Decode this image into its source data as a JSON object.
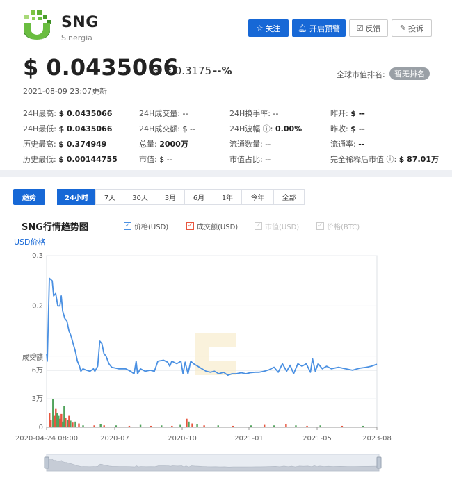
{
  "coin": {
    "symbol": "SNG",
    "name": "Sinergia"
  },
  "header_buttons": {
    "follow": "关注",
    "alert": "开启预警",
    "feedback": "反馈",
    "complain": "投诉"
  },
  "price": {
    "usd": "$ 0.0435066",
    "cny": "≈ ¥ 0.3175",
    "change": "--%",
    "rank_label": "全球市值排名:",
    "rank_value": "暂无排名",
    "updated": "2021-08-09 23:07更新"
  },
  "stats": [
    {
      "key": "24H最高:",
      "value": "$ 0.0435066"
    },
    {
      "key": "24H最低:",
      "value": "$ 0.0435066"
    },
    {
      "key": "历史最高:",
      "value": "$ 0.374949"
    },
    {
      "key": "历史最低:",
      "value": "$ 0.00144755"
    },
    {
      "key": "24H成交量:",
      "value": "--"
    },
    {
      "key": "24H成交额:",
      "value": "$ --"
    },
    {
      "key": "总量:",
      "value": "2000万"
    },
    {
      "key": "市值:",
      "value": "$ --"
    },
    {
      "key": "24H换手率:",
      "value": "--"
    },
    {
      "key": "24H波幅 ⓘ:",
      "value": "0.00%"
    },
    {
      "key": "流通数量:",
      "value": "--"
    },
    {
      "key": "市值占比:",
      "value": "--"
    },
    {
      "key": "昨开:",
      "value": "$ --"
    },
    {
      "key": "昨收:",
      "value": "$ --"
    },
    {
      "key": "流通率:",
      "value": "--"
    },
    {
      "key": "完全稀释后市值 ⓘ:",
      "value": "$ 87.01万"
    }
  ],
  "trend_button": "趋势",
  "ranges": [
    "24小时",
    "7天",
    "30天",
    "3月",
    "6月",
    "1年",
    "今年",
    "全部"
  ],
  "active_range": "24小时",
  "chart_title": "SNG行情趋势图",
  "legend": [
    {
      "label": "价格(USD)",
      "checked": true,
      "color": "#4a90e2"
    },
    {
      "label": "成交额(USD)",
      "checked": true,
      "color": "#e8553e"
    },
    {
      "label": "市值(USD)",
      "checked": true,
      "color": "#cccccc"
    },
    {
      "label": "价格(BTC)",
      "checked": true,
      "color": "#cccccc"
    }
  ],
  "colors": {
    "accent": "#1768d6",
    "price_line": "#4a90e2",
    "volume_up": "#e8553e",
    "volume_down": "#52a35c"
  },
  "chart_data": {
    "type": "line",
    "ylabel": "USD价格",
    "price_ylim": [
      0,
      0.3
    ],
    "price_yticks": [
      "0.3",
      "0.2",
      "0.1"
    ],
    "volume_label": "成交额",
    "volume_yticks": [
      "6万",
      "3万",
      "0"
    ],
    "volume_ylim": [
      0,
      60000
    ],
    "x_ticks": [
      "2020-04-24 08:00",
      "2020-07",
      "2020-10",
      "2021-01",
      "2021-05",
      "2023-08"
    ],
    "series": [
      {
        "name": "价格(USD)",
        "points": [
          [
            "2020-04-24",
            0.105
          ],
          [
            "2020-04-25",
            0.09
          ],
          [
            "2020-04-28",
            0.255
          ],
          [
            "2020-05-02",
            0.25
          ],
          [
            "2020-05-04",
            0.22
          ],
          [
            "2020-05-07",
            0.225
          ],
          [
            "2020-05-10",
            0.2
          ],
          [
            "2020-05-13",
            0.2
          ],
          [
            "2020-05-15",
            0.22
          ],
          [
            "2020-05-17",
            0.19
          ],
          [
            "2020-05-20",
            0.175
          ],
          [
            "2020-05-23",
            0.17
          ],
          [
            "2020-05-26",
            0.15
          ],
          [
            "2020-05-29",
            0.14
          ],
          [
            "2020-06-01",
            0.125
          ],
          [
            "2020-06-04",
            0.11
          ],
          [
            "2020-06-07",
            0.09
          ],
          [
            "2020-06-10",
            0.08
          ],
          [
            "2020-06-12",
            0.07
          ],
          [
            "2020-06-15",
            0.075
          ],
          [
            "2020-06-20",
            0.072
          ],
          [
            "2020-06-25",
            0.07
          ],
          [
            "2020-06-30",
            0.075
          ],
          [
            "2020-07-02",
            0.07
          ],
          [
            "2020-07-06",
            0.08
          ],
          [
            "2020-07-09",
            0.13
          ],
          [
            "2020-07-12",
            0.125
          ],
          [
            "2020-07-15",
            0.105
          ],
          [
            "2020-07-18",
            0.1
          ],
          [
            "2020-07-22",
            0.085
          ],
          [
            "2020-07-26",
            0.078
          ],
          [
            "2020-08-05",
            0.075
          ],
          [
            "2020-08-15",
            0.075
          ],
          [
            "2020-08-22",
            0.07
          ],
          [
            "2020-08-27",
            0.065
          ],
          [
            "2020-08-30",
            0.09
          ],
          [
            "2020-09-01",
            0.065
          ],
          [
            "2020-09-05",
            0.075
          ],
          [
            "2020-09-12",
            0.07
          ],
          [
            "2020-09-19",
            0.072
          ],
          [
            "2020-09-25",
            0.07
          ],
          [
            "2020-09-30",
            0.09
          ],
          [
            "2020-10-08",
            0.092
          ],
          [
            "2020-10-14",
            0.088
          ],
          [
            "2020-10-17",
            0.08
          ],
          [
            "2020-10-20",
            0.09
          ],
          [
            "2020-10-27",
            0.085
          ],
          [
            "2020-11-02",
            0.09
          ],
          [
            "2020-11-05",
            0.065
          ],
          [
            "2020-11-08",
            0.088
          ],
          [
            "2020-11-12",
            0.065
          ],
          [
            "2020-11-16",
            0.09
          ],
          [
            "2020-11-20",
            0.085
          ],
          [
            "2020-11-26",
            0.08
          ],
          [
            "2020-12-02",
            0.075
          ],
          [
            "2020-12-08",
            0.07
          ],
          [
            "2020-12-14",
            0.068
          ],
          [
            "2020-12-20",
            0.07
          ],
          [
            "2020-12-26",
            0.065
          ],
          [
            "2021-01-02",
            0.068
          ],
          [
            "2021-01-08",
            0.062
          ],
          [
            "2021-01-14",
            0.065
          ],
          [
            "2021-01-20",
            0.065
          ],
          [
            "2021-01-27",
            0.067
          ],
          [
            "2021-02-03",
            0.065
          ],
          [
            "2021-02-09",
            0.067
          ],
          [
            "2021-02-16",
            0.068
          ],
          [
            "2021-02-22",
            0.068
          ],
          [
            "2021-03-01",
            0.07
          ],
          [
            "2021-03-08",
            0.073
          ],
          [
            "2021-03-15",
            0.078
          ],
          [
            "2021-03-21",
            0.068
          ],
          [
            "2021-03-27",
            0.085
          ],
          [
            "2021-04-02",
            0.07
          ],
          [
            "2021-04-07",
            0.082
          ],
          [
            "2021-04-12",
            0.065
          ],
          [
            "2021-04-18",
            0.085
          ],
          [
            "2021-04-24",
            0.08
          ],
          [
            "2021-04-30",
            0.085
          ],
          [
            "2021-05-06",
            0.068
          ],
          [
            "2021-05-09",
            0.095
          ],
          [
            "2021-05-13",
            0.07
          ],
          [
            "2021-05-17",
            0.085
          ],
          [
            "2021-05-23",
            0.075
          ],
          [
            "2021-05-29",
            0.08
          ],
          [
            "2021-06-05",
            0.075
          ],
          [
            "2021-06-15",
            0.078
          ],
          [
            "2021-06-25",
            0.075
          ],
          [
            "2021-07-05",
            0.072
          ],
          [
            "2021-07-15",
            0.076
          ],
          [
            "2021-07-25",
            0.078
          ],
          [
            "2021-08-01",
            0.08
          ],
          [
            "2021-08-09",
            0.084
          ]
        ]
      }
    ],
    "volume_bars": [
      [
        "2020-04-28",
        15000,
        "down"
      ],
      [
        "2020-04-30",
        8000,
        "down"
      ],
      [
        "2020-05-03",
        30000,
        "up"
      ],
      [
        "2020-05-05",
        12000,
        "down"
      ],
      [
        "2020-05-07",
        20000,
        "down"
      ],
      [
        "2020-05-09",
        15000,
        "up"
      ],
      [
        "2020-05-11",
        12000,
        "up"
      ],
      [
        "2020-05-13",
        9000,
        "down"
      ],
      [
        "2020-05-15",
        14000,
        "down"
      ],
      [
        "2020-05-17",
        6000,
        "up"
      ],
      [
        "2020-05-19",
        22000,
        "up"
      ],
      [
        "2020-05-21",
        10000,
        "down"
      ],
      [
        "2020-05-24",
        8000,
        "up"
      ],
      [
        "2020-05-26",
        12000,
        "down"
      ],
      [
        "2020-05-28",
        7000,
        "up"
      ],
      [
        "2020-05-31",
        5000,
        "down"
      ],
      [
        "2020-06-04",
        6000,
        "up"
      ],
      [
        "2020-06-09",
        4000,
        "down"
      ],
      [
        "2020-06-15",
        2000,
        "up"
      ],
      [
        "2020-07-01",
        2000,
        "down"
      ],
      [
        "2020-07-10",
        3000,
        "up"
      ],
      [
        "2020-07-15",
        2000,
        "down"
      ],
      [
        "2020-08-01",
        2000,
        "up"
      ],
      [
        "2020-08-20",
        1500,
        "down"
      ],
      [
        "2020-09-05",
        2500,
        "up"
      ],
      [
        "2020-09-20",
        1500,
        "down"
      ],
      [
        "2020-10-05",
        2000,
        "up"
      ],
      [
        "2020-10-20",
        1500,
        "down"
      ],
      [
        "2020-11-01",
        2500,
        "up"
      ],
      [
        "2020-11-10",
        9000,
        "down"
      ],
      [
        "2020-11-13",
        6000,
        "up"
      ],
      [
        "2020-11-18",
        4000,
        "down"
      ],
      [
        "2020-11-25",
        3000,
        "up"
      ],
      [
        "2020-12-05",
        2000,
        "down"
      ],
      [
        "2020-12-25",
        2000,
        "up"
      ],
      [
        "2021-01-15",
        1500,
        "down"
      ],
      [
        "2021-02-10",
        2000,
        "up"
      ],
      [
        "2021-03-01",
        2500,
        "down"
      ],
      [
        "2021-03-15",
        2000,
        "up"
      ],
      [
        "2021-04-01",
        3000,
        "down"
      ],
      [
        "2021-04-15",
        2000,
        "up"
      ],
      [
        "2021-05-01",
        1500,
        "down"
      ],
      [
        "2021-05-20",
        2000,
        "up"
      ],
      [
        "2021-06-20",
        1500,
        "down"
      ],
      [
        "2021-07-20",
        1500,
        "up"
      ]
    ],
    "grid": true
  }
}
